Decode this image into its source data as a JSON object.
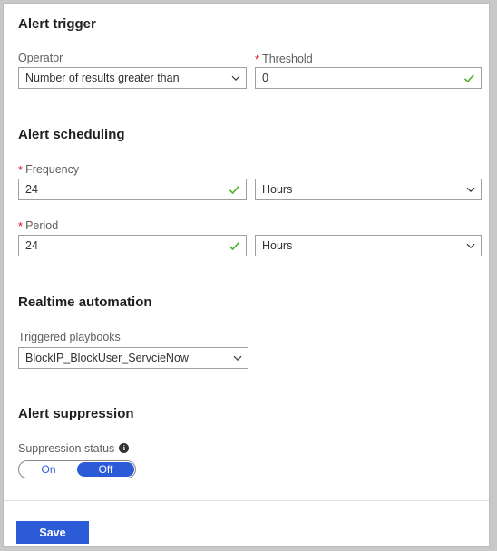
{
  "sections": {
    "alert_trigger": {
      "title": "Alert trigger",
      "operator": {
        "label": "Operator",
        "value": "Number of results greater than",
        "icon": "chevron-down-icon"
      },
      "threshold": {
        "label": "Threshold",
        "required_marker": "*",
        "value": "0",
        "validation_icon": "checkmark-icon"
      }
    },
    "alert_scheduling": {
      "title": "Alert scheduling",
      "frequency": {
        "label": "Frequency",
        "required_marker": "*",
        "value": "24",
        "validation_icon": "checkmark-icon",
        "unit": "Hours",
        "unit_icon": "chevron-down-icon"
      },
      "period": {
        "label": "Period",
        "required_marker": "*",
        "value": "24",
        "validation_icon": "checkmark-icon",
        "unit": "Hours",
        "unit_icon": "chevron-down-icon"
      }
    },
    "realtime_automation": {
      "title": "Realtime automation",
      "triggered_playbooks": {
        "label": "Triggered playbooks",
        "value": "BlockIP_BlockUser_ServcieNow",
        "icon": "chevron-down-icon"
      }
    },
    "alert_suppression": {
      "title": "Alert suppression",
      "suppression_status": {
        "label": "Suppression status",
        "info_icon": "info-icon",
        "options": [
          "On",
          "Off"
        ],
        "selected": "Off"
      }
    }
  },
  "footer": {
    "save_label": "Save"
  },
  "colors": {
    "accent": "#2b5bd7",
    "required": "#e00b1c",
    "valid": "#4caf1d",
    "label": "#605e5c",
    "border": "#a19f9d"
  }
}
